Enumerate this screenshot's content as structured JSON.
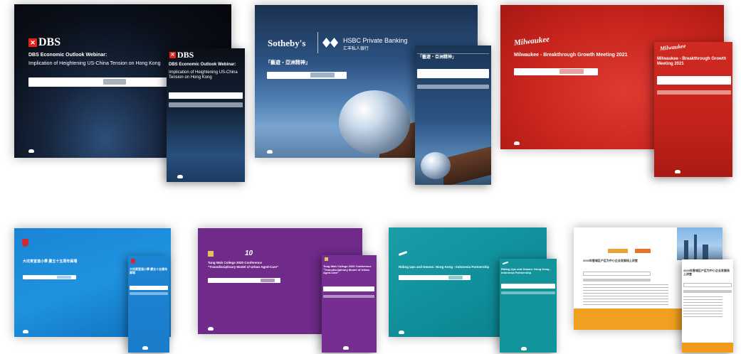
{
  "dbs": {
    "logo": "DBS",
    "title": "DBS Economic Outlook Webinar:",
    "subtitle": "Implication of Heightening US-China Tension on Hong Kong",
    "mobile_title": "DBS Economic Outlook Webinar:",
    "mobile_subtitle": "Implication of Heightening US-China Tension on Hong Kong"
  },
  "hsbc": {
    "partner_left": "Sotheby's",
    "partner_right_line1": "HSBC Private Banking",
    "partner_right_line2": "汇丰私人银行",
    "title": "「藝遊・亞洲精神」",
    "mobile_title": "「藝遊・亞洲精神」"
  },
  "milwaukee": {
    "logo": "Milwaukee",
    "title": "Milwaukee - Breakthrough Growth Meeting 2021",
    "mobile_title": "Milwaukee - Breakthrough Growth Meeting 2021"
  },
  "school": {
    "title": "大坑東宣道小學 慶五十五周年兩場",
    "mobile_title": "大坑東宣道小學 慶五十五周年兩場"
  },
  "tungwah": {
    "title": "Tung Wah College 2020 Conference",
    "subtitle": "\"Transdisciplinary Model of Urban Aged-Care\"",
    "mobile_title": "Tung Wah College 2020 Conference \"Transdisciplinary Model of Urban Aged-Care\""
  },
  "teal": {
    "title": "Riding Ups and Downs: Hong Kong - Indonesia Partnership",
    "mobile_title": "Riding Ups and Downs: Hong Kong - Indonesia Partnership"
  },
  "orange": {
    "title": "2020年香城区户区为中小企业发展线上讲堂",
    "mobile_title": "2020年香城区户区为中小企业发展线上讲堂"
  },
  "colors": {
    "dbs_red": "#e2231a",
    "milwaukee_red": "#c8251e",
    "school_blue": "#1f93e0",
    "tungwah_purple": "#6f2a8a",
    "teal": "#0f8d98",
    "orange": "#f0a020"
  }
}
